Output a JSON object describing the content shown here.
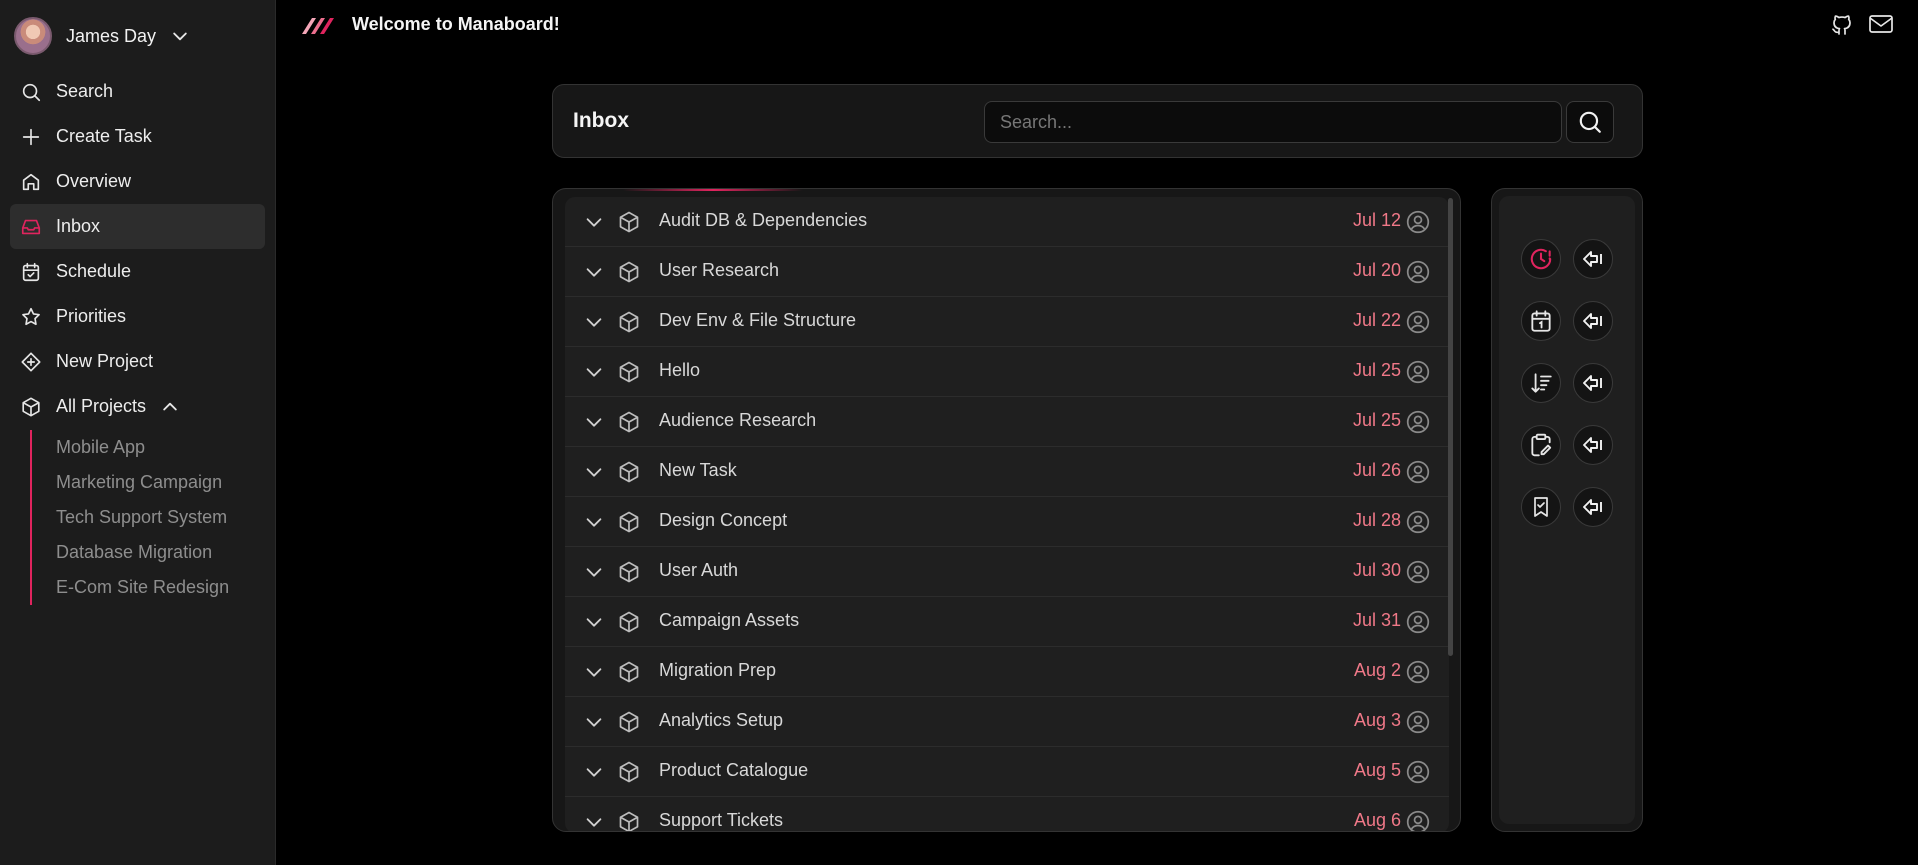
{
  "user": {
    "name": "James Day"
  },
  "sidebar": {
    "nav": [
      {
        "label": "Search",
        "icon": "search-icon"
      },
      {
        "label": "Create Task",
        "icon": "plus-icon"
      },
      {
        "label": "Overview",
        "icon": "home-icon"
      },
      {
        "label": "Inbox",
        "icon": "inbox-icon",
        "active": true
      },
      {
        "label": "Schedule",
        "icon": "calendar-check-icon"
      },
      {
        "label": "Priorities",
        "icon": "star-icon"
      },
      {
        "label": "New Project",
        "icon": "diamond-plus-icon"
      },
      {
        "label": "All Projects",
        "icon": "cube-icon"
      }
    ],
    "projects": [
      "Mobile App",
      "Marketing Campaign",
      "Tech Support System",
      "Database Migration",
      "E-Com Site Redesign"
    ]
  },
  "header": {
    "title": "Welcome to Manaboard!"
  },
  "inbox": {
    "title": "Inbox",
    "search_placeholder": "Search...",
    "tasks": [
      {
        "name": "Audit DB & Dependencies",
        "date": "Jul 12"
      },
      {
        "name": "User Research",
        "date": "Jul 20"
      },
      {
        "name": "Dev Env & File Structure",
        "date": "Jul 22"
      },
      {
        "name": "Hello",
        "date": "Jul 25"
      },
      {
        "name": "Audience Research",
        "date": "Jul 25"
      },
      {
        "name": "New Task",
        "date": "Jul 26"
      },
      {
        "name": "Design Concept",
        "date": "Jul 28"
      },
      {
        "name": "User Auth",
        "date": "Jul 30"
      },
      {
        "name": "Campaign Assets",
        "date": "Jul 31"
      },
      {
        "name": "Migration Prep",
        "date": "Aug 2"
      },
      {
        "name": "Analytics Setup",
        "date": "Aug 3"
      },
      {
        "name": "Product Catalogue",
        "date": "Aug 5"
      },
      {
        "name": "Support Tickets",
        "date": "Aug 6"
      }
    ]
  },
  "filters": [
    {
      "icon": "clock-alert-icon",
      "active": true
    },
    {
      "icon": "calendar-icon"
    },
    {
      "icon": "sort-descending-icon"
    },
    {
      "icon": "clipboard-pen-icon"
    },
    {
      "icon": "bookmark-check-icon"
    }
  ],
  "colors": {
    "accent": "#e0245e",
    "date": "#f07888",
    "background": "#000000",
    "sidebar": "#1c1c1c"
  }
}
